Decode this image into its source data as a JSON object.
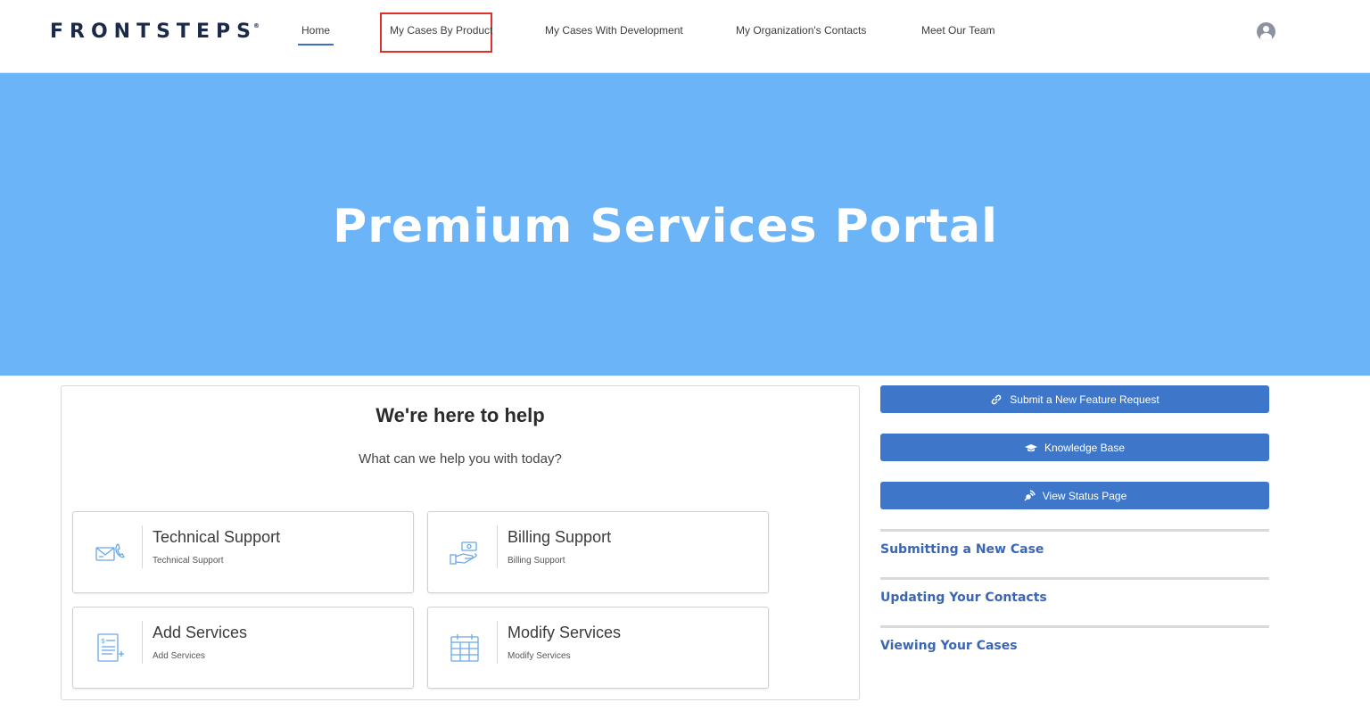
{
  "header": {
    "logo_text": "FRONTSTEPS",
    "logo_mark": "®",
    "nav": {
      "home": "Home",
      "cases_by_product": "My Cases By Product",
      "cases_with_development": "My Cases With Development",
      "organization_contacts": "My Organization's Contacts",
      "meet_team": "Meet Our Team"
    }
  },
  "hero": {
    "title": "Premium Services Portal",
    "background_color": "#6bb4f8"
  },
  "help": {
    "title": "We're here to help",
    "subtitle": "What can we help you with today?",
    "tiles": [
      {
        "title": "Technical Support",
        "description": "Technical Support",
        "icon": "envelope-phone-icon"
      },
      {
        "title": "Billing Support",
        "description": "Billing Support",
        "icon": "hand-money-icon"
      },
      {
        "title": "Add Services",
        "description": "Add Services",
        "icon": "invoice-add-icon"
      },
      {
        "title": "Modify Services",
        "description": "Modify Services",
        "icon": "calendar-icon"
      }
    ]
  },
  "sidebar": {
    "buttons": [
      {
        "label": "Submit a New Feature Request",
        "icon": "link-icon"
      },
      {
        "label": "Knowledge Base",
        "icon": "graduation-cap-icon"
      },
      {
        "label": "View Status Page",
        "icon": "broadcast-icon"
      }
    ],
    "links": [
      {
        "label": "Submitting a New Case"
      },
      {
        "label": "Updating Your Contacts"
      },
      {
        "label": "Viewing Your Cases"
      }
    ],
    "button_color": "#3e77c9",
    "link_color": "#3a66b3"
  },
  "highlight_color": "#e0302b"
}
